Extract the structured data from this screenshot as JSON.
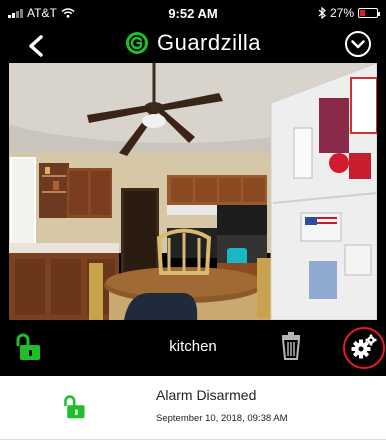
{
  "status_bar": {
    "carrier": "AT&T",
    "time": "9:52 AM",
    "battery_percent": "27%",
    "battery_level": 0.27
  },
  "header": {
    "app_name": "Guardzilla",
    "back_icon": "chevron-left-icon",
    "menu_icon": "chevron-down-circle-icon"
  },
  "camera": {
    "name": "kitchen"
  },
  "controls": {
    "lock_icon": "unlocked-padlock-icon",
    "trash_icon": "trash-icon",
    "settings_icon": "gears-icon"
  },
  "events": [
    {
      "title": "Alarm Disarmed",
      "timestamp": "September 10, 2018, 09:38 AM",
      "icon": "unlocked-padlock-icon"
    }
  ],
  "colors": {
    "accent_green": "#1fbf2a",
    "highlight_red": "#e3192b",
    "background": "#000000"
  }
}
